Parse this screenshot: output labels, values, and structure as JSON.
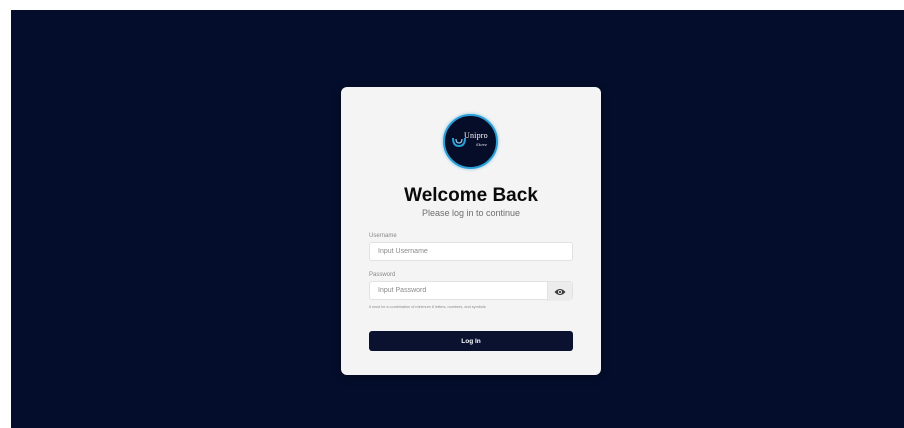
{
  "colors": {
    "page_background": "#040d2b",
    "card_background": "#f4f4f4",
    "button_background": "#0a1230",
    "logo_ring": "#2a9fd6"
  },
  "logo": {
    "brand": "Unipro",
    "tagline": "Store",
    "icon": "unipro-logo-icon"
  },
  "header": {
    "title": "Welcome Back",
    "subtitle": "Please log in to continue"
  },
  "form": {
    "username": {
      "label": "Username",
      "placeholder": "Input Username",
      "value": ""
    },
    "password": {
      "label": "Password",
      "placeholder": "Input Password",
      "value": "",
      "toggle_icon": "eye-icon",
      "hint": "it must be a combination of minimum 8 letters, numbers, and symbols"
    },
    "submit_label": "Log In"
  }
}
